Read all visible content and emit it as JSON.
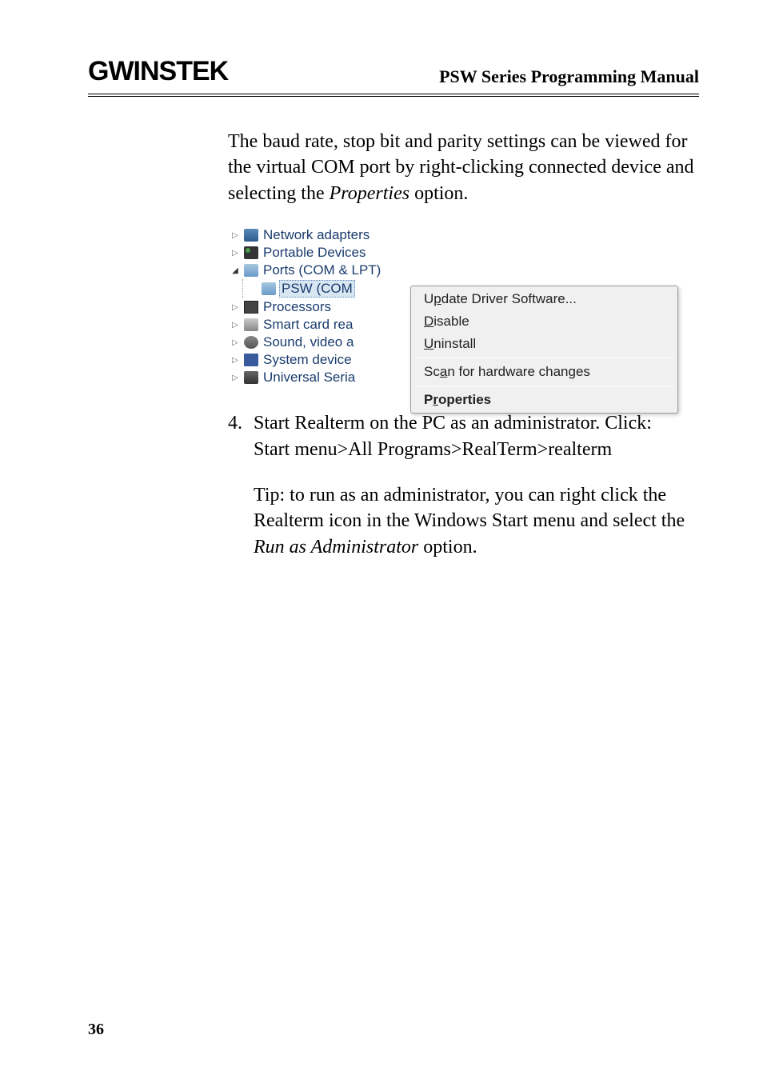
{
  "header": {
    "logo": "GWINSTEK",
    "title": "PSW Series Programming Manual"
  },
  "intro_text": "The baud rate, stop bit and parity settings can be viewed for the virtual COM port by right-clicking connected device and selecting the ",
  "intro_italic": "Properties",
  "intro_suffix": " option.",
  "tree": {
    "items": [
      {
        "label": "Network adapters",
        "expanded": false
      },
      {
        "label": "Portable Devices",
        "expanded": false
      },
      {
        "label": "Ports (COM & LPT)",
        "expanded": true
      },
      {
        "label": "PSW (COM",
        "child": true,
        "highlighted": true
      },
      {
        "label": "Processors",
        "expanded": false
      },
      {
        "label": "Smart card rea",
        "expanded": false
      },
      {
        "label": "Sound, video a",
        "expanded": false
      },
      {
        "label": "System device",
        "expanded": false
      },
      {
        "label": "Universal Seria",
        "expanded": false
      }
    ]
  },
  "context_menu": {
    "items": [
      {
        "text": "Update Driver Software...",
        "underline_pos": "p"
      },
      {
        "text": "Disable",
        "underline_pos": "D"
      },
      {
        "text": "Uninstall",
        "underline_pos": "U"
      },
      {
        "divider": true
      },
      {
        "text": "Scan for hardware changes",
        "underline_pos": "a"
      },
      {
        "divider": true
      },
      {
        "text": "Properties",
        "underline_pos": "r",
        "bold": true
      }
    ]
  },
  "step": {
    "number": "4.",
    "line1": "Start Realterm on the PC as an administrator. Click:",
    "line2": " Start menu>All Programs>RealTerm>realterm"
  },
  "tip": {
    "prefix": "Tip: to run as an administrator, you can right click the Realterm icon in the Windows Start menu and select the ",
    "italic": "Run as Administrator",
    "suffix": " option."
  },
  "page_number": "36"
}
